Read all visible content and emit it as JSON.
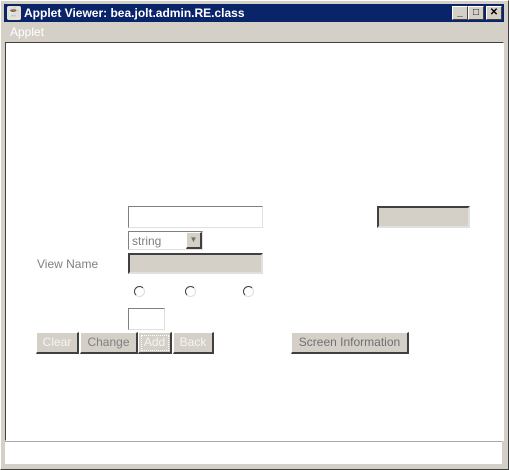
{
  "window": {
    "title": "Applet Viewer: bea.jolt.admin.RE.class",
    "icon": "java-icon",
    "controls": [
      "minimize",
      "maximize",
      "close"
    ]
  },
  "menu": {
    "items": [
      "Applet"
    ]
  },
  "form": {
    "type_select": {
      "value": "string"
    },
    "view_name_label": "View Name",
    "radios": [
      {
        "checked": false
      },
      {
        "checked": false
      },
      {
        "checked": false
      }
    ]
  },
  "buttons": {
    "clear": "Clear",
    "change": "Change",
    "add": "Add",
    "back": "Back",
    "screen_info": "Screen Information"
  }
}
